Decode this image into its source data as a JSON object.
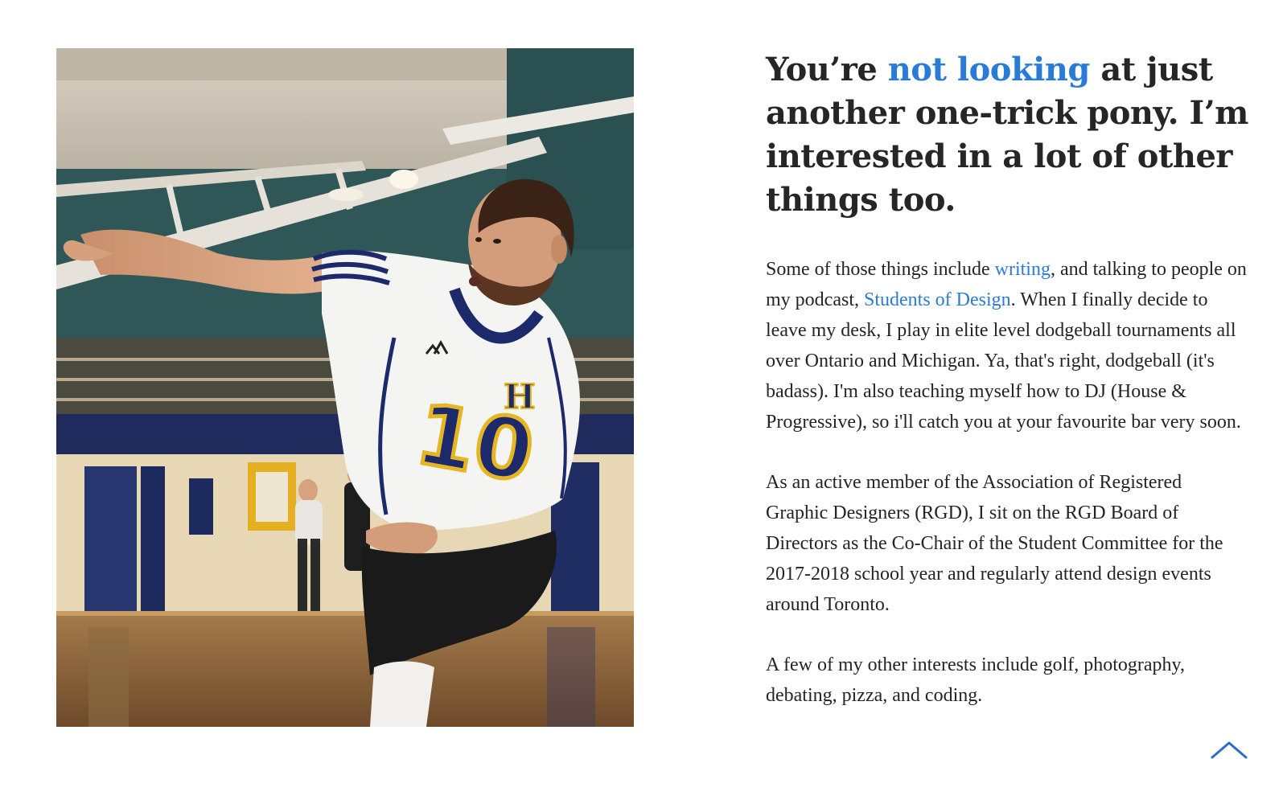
{
  "photo": {
    "jersey_number": "10",
    "crest_letter": "H"
  },
  "headline": {
    "part1": "You’re ",
    "accent": "not looking",
    "part2": " at just another one-trick pony. I’m interested in a lot of other things too."
  },
  "paragraphs": {
    "p1": {
      "t1": "Some of those things include ",
      "link1": "writing",
      "t2": ", and talking to people on my podcast, ",
      "link2": "Students of Design",
      "t3": ". When I finally decide to leave my desk, I play in elite level dodgeball tournaments all over Ontario and Michigan. Ya, that's right, dodgeball (it's badass). I'm also teaching myself how to DJ (House & Progressive), so i'll catch you at your favourite bar very soon."
    },
    "p2": "As an active member of the Association of Registered Graphic Designers (RGD), I sit on the RGD Board of Directors as the Co-Chair of the Student Committee for the 2017-2018 school year and regularly attend design events around Toronto.",
    "p3": "A few of my other interests include golf, photography, debating, pizza, and coding."
  },
  "colors": {
    "accent": "#2a7bd6",
    "text": "#242424",
    "jersey_navy": "#1c2a6b",
    "jersey_gold": "#e5b623"
  },
  "icons": {
    "back_to_top": "chevron-up-icon"
  }
}
